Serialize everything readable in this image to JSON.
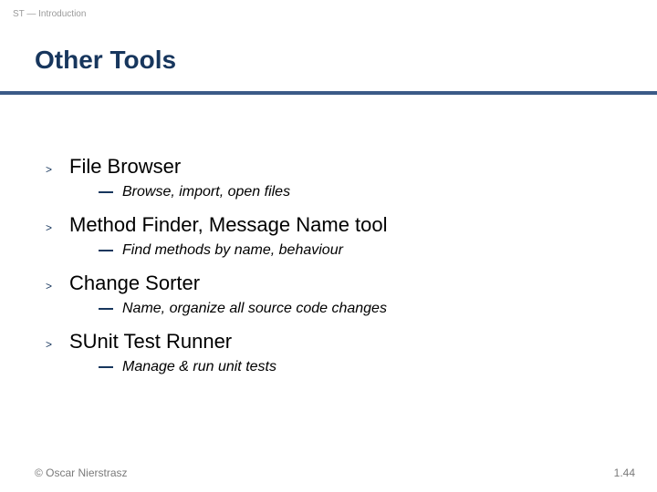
{
  "breadcrumb": "ST — Introduction",
  "title": "Other Tools",
  "items": [
    {
      "title": "File Browser",
      "sub": "Browse, import, open files"
    },
    {
      "title": "Method Finder, Message Name tool",
      "sub": "Find methods by name, behaviour"
    },
    {
      "title": "Change Sorter",
      "sub": "Name, organize all source code changes"
    },
    {
      "title": "SUnit Test Runner",
      "sub": "Manage & run unit tests"
    }
  ],
  "footer": {
    "copyright": "© Oscar Nierstrasz",
    "page": "1.44"
  },
  "glyphs": {
    "caret": ">"
  }
}
